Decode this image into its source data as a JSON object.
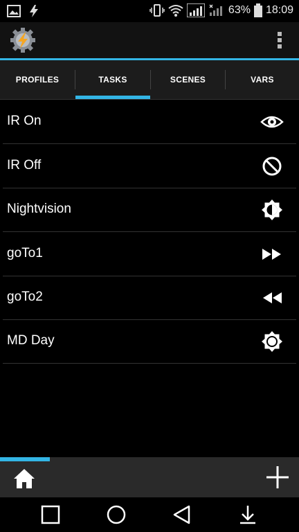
{
  "status_bar": {
    "battery": "63%",
    "time": "18:09"
  },
  "tabs": [
    {
      "label": "PROFILES",
      "selected": false
    },
    {
      "label": "TASKS",
      "selected": true
    },
    {
      "label": "SCENES",
      "selected": false
    },
    {
      "label": "VARS",
      "selected": false
    }
  ],
  "tasks": [
    {
      "label": "IR On",
      "icon": "eye-icon"
    },
    {
      "label": "IR Off",
      "icon": "block-icon"
    },
    {
      "label": "Nightvision",
      "icon": "brightness-icon"
    },
    {
      "label": "goTo1",
      "icon": "fast-forward-icon"
    },
    {
      "label": "goTo2",
      "icon": "rewind-icon"
    },
    {
      "label": "MD Day",
      "icon": "sun-icon"
    }
  ],
  "colors": {
    "accent": "#33b5e5",
    "background": "#000000"
  }
}
